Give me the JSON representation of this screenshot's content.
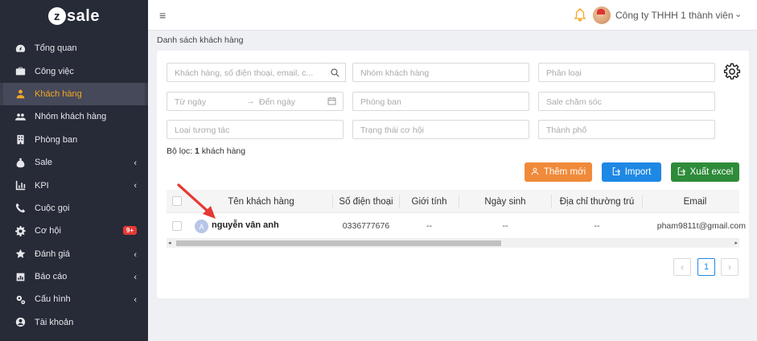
{
  "brand": {
    "logo_letter": "z",
    "logo_text": "sale"
  },
  "sidebar": {
    "items": [
      {
        "label": "Tổng quan",
        "icon": "dashboard-icon"
      },
      {
        "label": "Công việc",
        "icon": "briefcase-icon"
      },
      {
        "label": "Khách hàng",
        "icon": "user-icon",
        "active": true
      },
      {
        "label": "Nhóm khách hàng",
        "icon": "users-icon"
      },
      {
        "label": "Phòng ban",
        "icon": "building-icon"
      },
      {
        "label": "Sale",
        "icon": "moneybag-icon",
        "chevron": "‹"
      },
      {
        "label": "KPI",
        "icon": "chart-icon",
        "chevron": "‹"
      },
      {
        "label": "Cuộc gọi",
        "icon": "phone-icon"
      },
      {
        "label": "Cơ hội",
        "icon": "gear-icon",
        "badge": "9+"
      },
      {
        "label": "Đánh giá",
        "icon": "star-icon",
        "chevron": "‹"
      },
      {
        "label": "Báo cáo",
        "icon": "report-icon",
        "chevron": "‹"
      },
      {
        "label": "Cấu hình",
        "icon": "cogs-icon",
        "chevron": "‹"
      },
      {
        "label": "Tài khoản",
        "icon": "account-icon"
      }
    ]
  },
  "topbar": {
    "menu_glyph": "≡",
    "company": "Công ty THHH 1 thành viên",
    "company_chevron": "⌄"
  },
  "page": {
    "breadcrumb": "Danh sách khách hàng"
  },
  "filters": {
    "search_placeholder": "Khách hàng, số điện thoại, email, c...",
    "customer_group": "Nhóm khách hàng",
    "category": "Phân loại",
    "from_date": "Từ ngày",
    "date_arrow": "→",
    "to_date": "Đến ngày",
    "department": "Phòng ban",
    "sale_care": "Sale chăm sóc",
    "interaction_type": "Loại tương tác",
    "opportunity_status": "Trạng thái cơ hội",
    "city": "Thành phố",
    "filter_label": "Bộ lọc:",
    "filter_count": "1",
    "filter_suffix": "khách hàng"
  },
  "actions": {
    "add": "Thêm mới",
    "import": "Import",
    "export": "Xuất excel"
  },
  "table": {
    "headers": [
      "Tên khách hàng",
      "Số điện thoại",
      "Giới tính",
      "Ngày sinh",
      "Địa chỉ thường trú",
      "Email"
    ],
    "rows": [
      {
        "avatar": "A",
        "name": "nguyễn vân anh",
        "phone": "0336777676",
        "gender": "--",
        "birthday": "--",
        "address": "--",
        "email": "pham9811t@gmail.com"
      }
    ]
  },
  "pagination": {
    "prev": "‹",
    "current": "1",
    "next": "›"
  },
  "colors": {
    "sidebar_bg": "#272a37",
    "active_accent": "#f5a623",
    "orange": "#f08a3a",
    "blue": "#1e88e5",
    "green": "#2e8b3a",
    "arrow": "#e53935"
  }
}
